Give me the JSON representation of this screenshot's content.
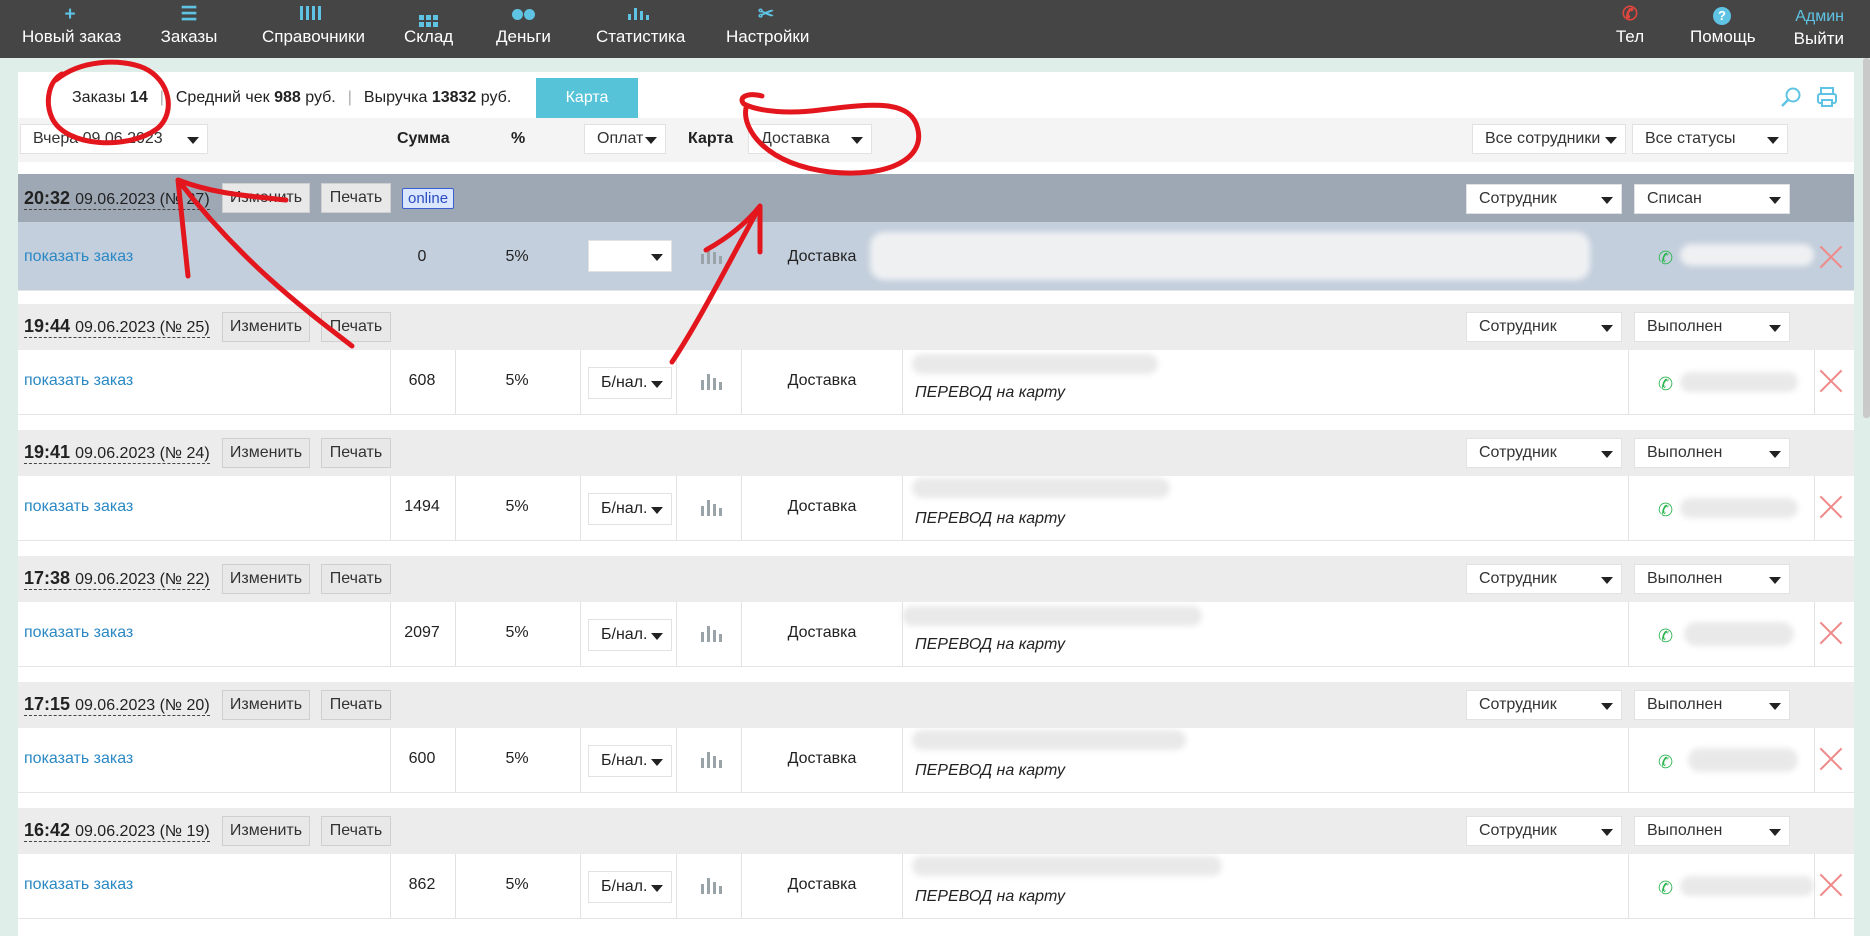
{
  "nav": {
    "items": [
      {
        "label": "Новый заказ",
        "icon": "plus-icon"
      },
      {
        "label": "Заказы",
        "icon": "list-icon"
      },
      {
        "label": "Справочники",
        "icon": "catalog-icon"
      },
      {
        "label": "Склад",
        "icon": "grid-icon"
      },
      {
        "label": "Деньги",
        "icon": "coins-icon"
      },
      {
        "label": "Статистика",
        "icon": "stats-icon"
      },
      {
        "label": "Настройки",
        "icon": "settings-icon"
      }
    ],
    "tel_label": "Тел",
    "help_label": "Помощь",
    "admin_label": "Админ",
    "logout_label": "Выйти",
    "accent_color": "#5fc3e4"
  },
  "stats": {
    "orders_label": "Заказы",
    "orders_count": "14",
    "avg_label": "Средний чек",
    "avg_value": "988",
    "avg_unit": "руб.",
    "revenue_label": "Выручка",
    "revenue_value": "13832",
    "revenue_unit": "руб.",
    "map_tab": "Карта"
  },
  "filters": {
    "date": "Вчера 09.06.2023",
    "sum_header": "Сумма",
    "pct_header": "%",
    "payment": "Оплат",
    "card_header": "Карта",
    "delivery": "Доставка",
    "employees": "Все сотрудники",
    "statuses": "Все статусы"
  },
  "orders": [
    {
      "time": "20:32",
      "date": "09.06.2023 (№ 27)",
      "edit": "Изменить",
      "print": "Печать",
      "badge": "online",
      "employee": "Сотрудник",
      "status": "Списан",
      "link": "показать заказ",
      "sum": "0",
      "pct": "5%",
      "payment": "",
      "delivery": "Доставка",
      "note": ""
    },
    {
      "time": "19:44",
      "date": "09.06.2023 (№ 25)",
      "edit": "Изменить",
      "print": "Печать",
      "employee": "Сотрудник",
      "status": "Выполнен",
      "link": "показать заказ",
      "sum": "608",
      "pct": "5%",
      "payment": "Б/нал.",
      "delivery": "Доставка",
      "note": "ПЕРЕВОД на карту"
    },
    {
      "time": "19:41",
      "date": "09.06.2023 (№ 24)",
      "edit": "Изменить",
      "print": "Печать",
      "employee": "Сотрудник",
      "status": "Выполнен",
      "link": "показать заказ",
      "sum": "1494",
      "pct": "5%",
      "payment": "Б/нал.",
      "delivery": "Доставка",
      "note": "ПЕРЕВОД на карту"
    },
    {
      "time": "17:38",
      "date": "09.06.2023 (№ 22)",
      "edit": "Изменить",
      "print": "Печать",
      "employee": "Сотрудник",
      "status": "Выполнен",
      "link": "показать заказ",
      "sum": "2097",
      "pct": "5%",
      "payment": "Б/нал.",
      "delivery": "Доставка",
      "note": "ПЕРЕВОД на карту"
    },
    {
      "time": "17:15",
      "date": "09.06.2023 (№ 20)",
      "edit": "Изменить",
      "print": "Печать",
      "employee": "Сотрудник",
      "status": "Выполнен",
      "link": "показать заказ",
      "sum": "600",
      "pct": "5%",
      "payment": "Б/нал.",
      "delivery": "Доставка",
      "note": "ПЕРЕВОД на карту"
    },
    {
      "time": "16:42",
      "date": "09.06.2023 (№ 19)",
      "edit": "Изменить",
      "print": "Печать",
      "employee": "Сотрудник",
      "status": "Выполнен",
      "link": "показать заказ",
      "sum": "862",
      "pct": "5%",
      "payment": "Б/нал.",
      "delivery": "Доставка",
      "note": "ПЕРЕВОД на карту"
    }
  ]
}
